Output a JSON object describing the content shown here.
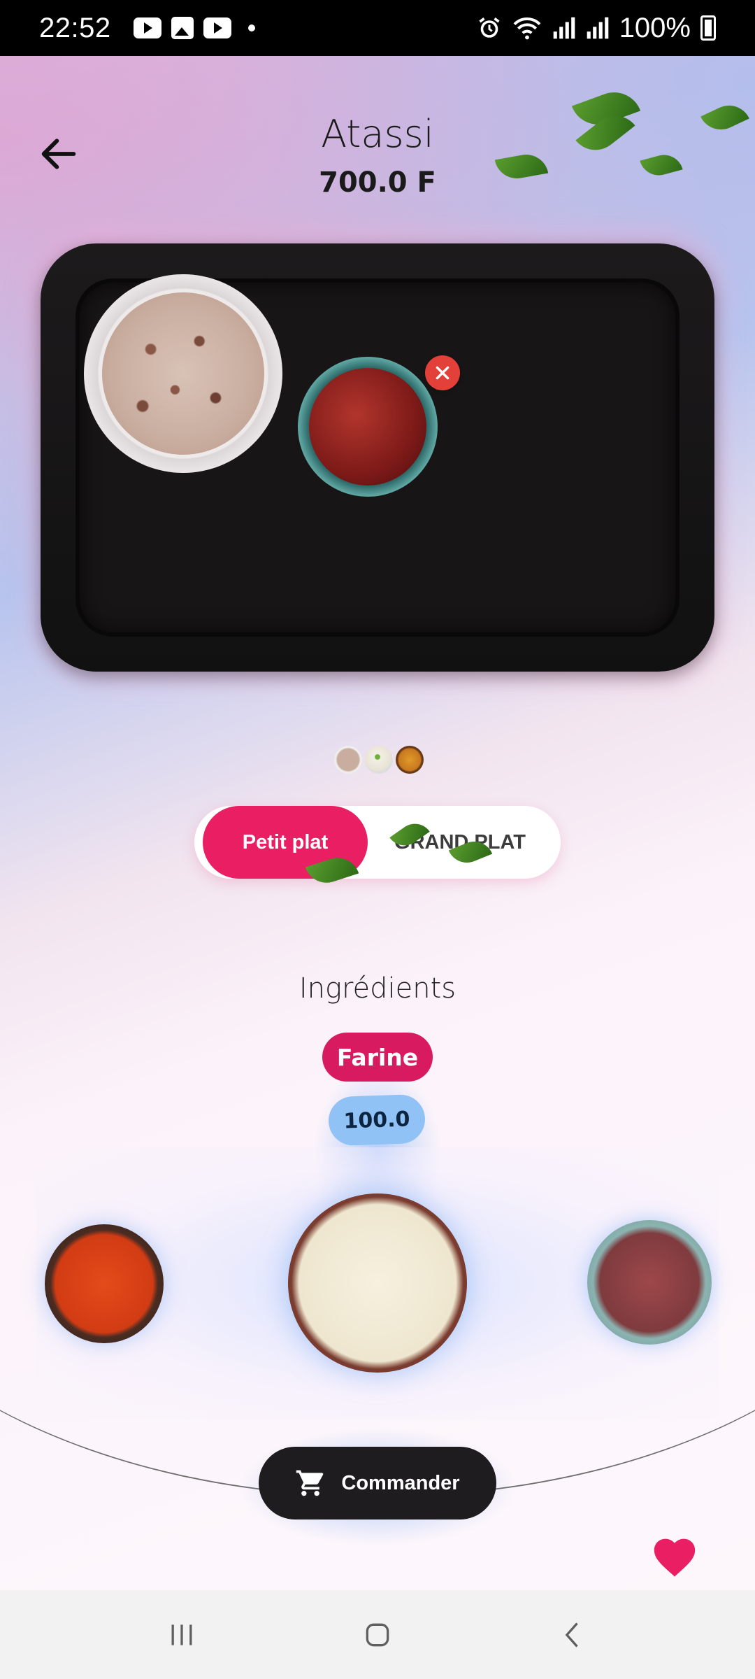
{
  "status_bar": {
    "time": "22:52",
    "battery": "100%",
    "notification_icons": [
      "youtube-icon",
      "gallery-icon",
      "youtube-icon"
    ],
    "system_icons": [
      "alarm-icon",
      "wifi-icon",
      "signal-icon",
      "signal-icon",
      "battery-charging-icon"
    ]
  },
  "header": {
    "title": "Atassi",
    "price": "700.0 F"
  },
  "plate": {
    "items": [
      "rice-with-beans",
      "red-sauce"
    ],
    "thumbnails": [
      "rice-with-beans",
      "white-rice",
      "spiced-rice"
    ]
  },
  "size_toggle": {
    "small_label": "Petit plat",
    "large_label": "GRAND PLAT",
    "selected": "small"
  },
  "ingredients": {
    "section_title": "Ingrédients",
    "selected_name": "Farine",
    "selected_quantity": "100.0",
    "items": [
      "paprika",
      "farine",
      "sauce"
    ]
  },
  "actions": {
    "order_label": "Commander"
  },
  "colors": {
    "accent": "#e91e63",
    "order_button": "#1f1c20",
    "quantity_badge": "#90c2f5",
    "remove_button": "#e3403a"
  }
}
